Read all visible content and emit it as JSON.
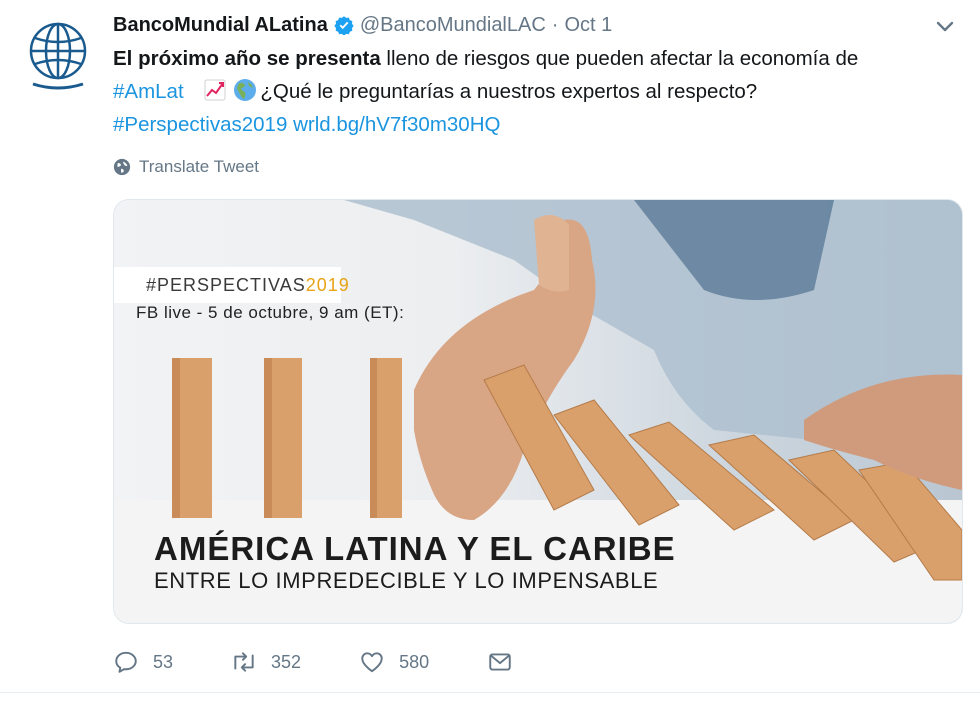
{
  "tweet": {
    "author_name": "BancoMundial ALatina",
    "handle": "@BancoMundialLAC",
    "separator": "·",
    "date": "Oct 1",
    "text_bold": "El próximo año se presenta",
    "text_rest_line1": " lleno de riesgos que pueden afectar la economía de",
    "hashtag_amlat": "#AmLat",
    "text_question": "¿Qué le preguntarías a nuestros expertos al respecto?",
    "hashtag_perspectivas": "#Perspectivas2019",
    "url": "wrld.bg/hV7f30m30HQ",
    "translate_label": "Translate Tweet"
  },
  "media": {
    "hashtag_main": "#PERSPECTIVAS",
    "hashtag_year": "2019",
    "event_line": "FB live - 5 de octubre, 9 am (ET):",
    "headline": "AMÉRICA LATINA Y EL CARIBE",
    "subheadline": "ENTRE LO IMPREDECIBLE Y LO IMPENSABLE"
  },
  "actions": {
    "replies": "53",
    "retweets": "352",
    "likes": "580"
  },
  "colors": {
    "link": "#1b95e0",
    "muted": "#657786",
    "verified": "#1da1f2",
    "hashtag_year": "#e8a317"
  },
  "icons": [
    "globe-logo-icon",
    "verified-badge-icon",
    "chevron-down-icon",
    "chart-increasing-emoji",
    "earth-americas-emoji",
    "globe-icon",
    "reply-icon",
    "retweet-icon",
    "like-icon",
    "direct-message-icon"
  ]
}
